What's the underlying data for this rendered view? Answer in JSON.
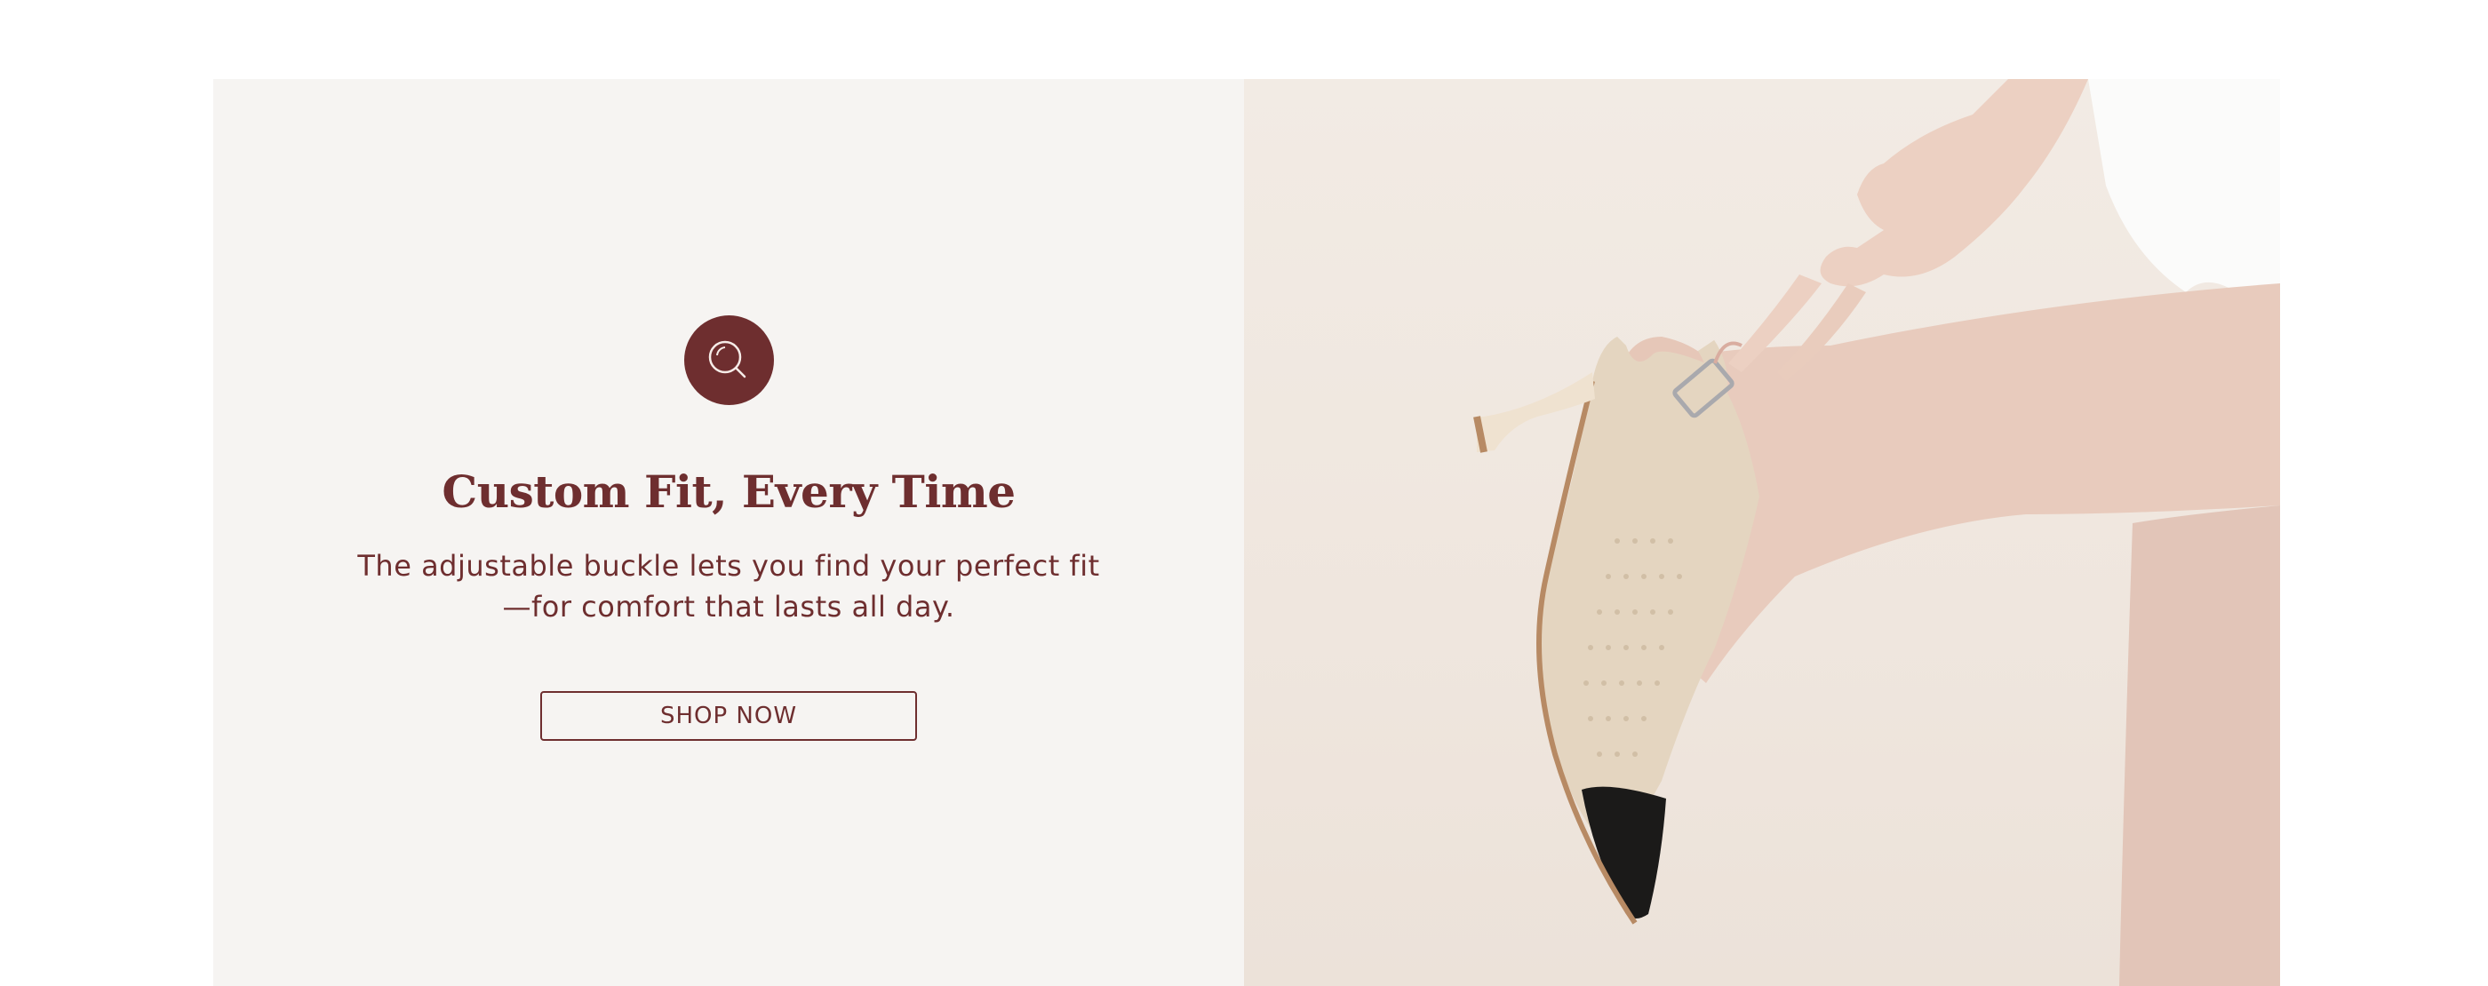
{
  "banner": {
    "icon": "magnifier-icon",
    "heading": "Custom Fit, Every Time",
    "subtext": "The adjustable buckle lets you find your perfect fit—for comfort that lasts all day.",
    "button_label": "SHOP NOW"
  },
  "image": {
    "description_icon": "shoe-photo"
  },
  "colors": {
    "brand": "#6e2e2f",
    "panel_bg": "#f6f4f2",
    "photo_bg": "#efe6de"
  }
}
